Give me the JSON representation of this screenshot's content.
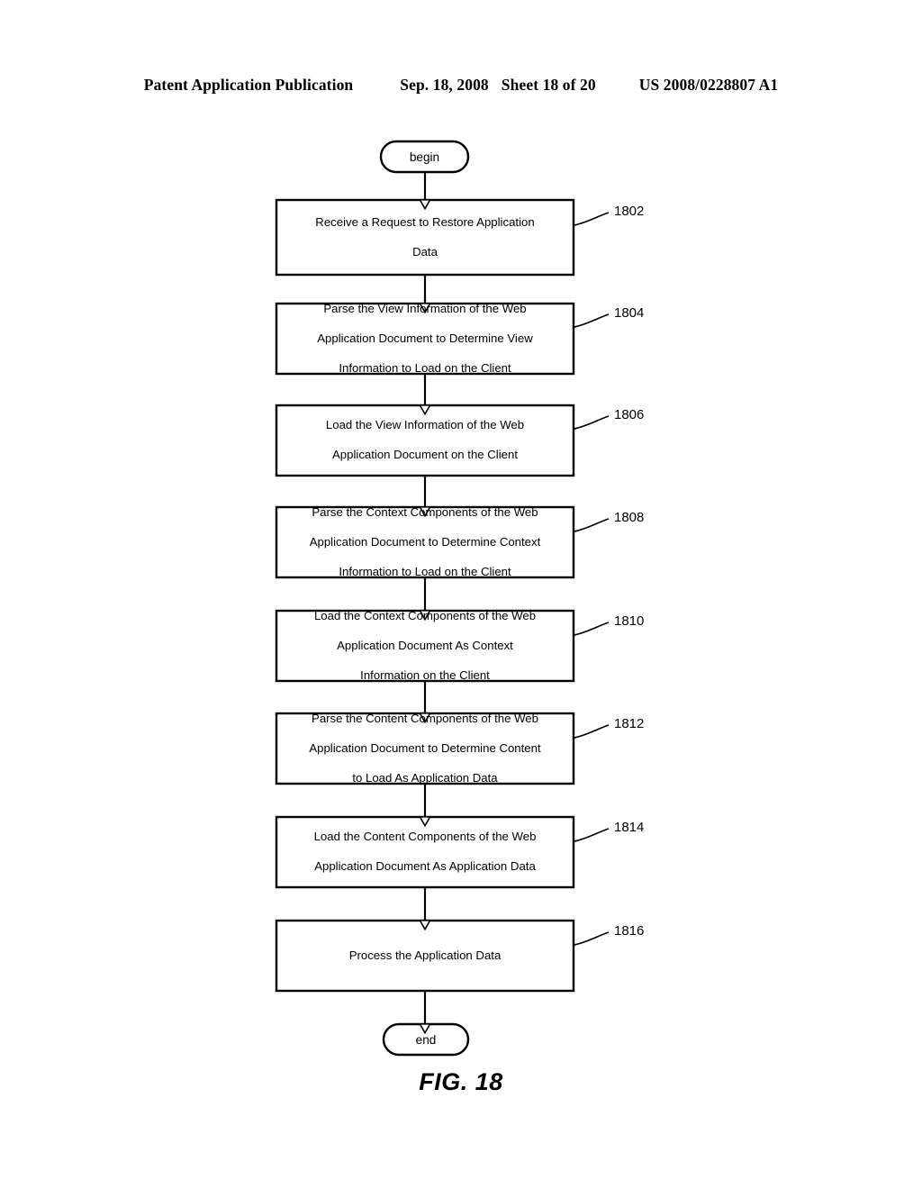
{
  "header": {
    "publication": "Patent Application Publication",
    "date": "Sep. 18, 2008",
    "sheet": "Sheet 18 of 20",
    "patent_number": "US 2008/0228807 A1"
  },
  "figure": {
    "caption": "FIG. 18",
    "start_label": "begin",
    "end_label": "end"
  },
  "flow": {
    "steps": [
      {
        "ref": "1802",
        "lines": [
          "Receive a Request to Restore Application",
          "Data"
        ]
      },
      {
        "ref": "1804",
        "lines": [
          "Parse the View Information of the Web",
          "Application Document to Determine View",
          "Information to Load on the Client"
        ]
      },
      {
        "ref": "1806",
        "lines": [
          "Load the View Information of the Web",
          "Application Document on the Client"
        ]
      },
      {
        "ref": "1808",
        "lines": [
          "Parse the Context Components of the Web",
          "Application Document to Determine Context",
          "Information to Load on the Client"
        ]
      },
      {
        "ref": "1810",
        "lines": [
          "Load the Context Components of the Web",
          "Application Document As Context",
          "Information on the Client"
        ]
      },
      {
        "ref": "1812",
        "lines": [
          "Parse the Content Components of the Web",
          "Application Document to Determine Content",
          "to Load As Application Data"
        ]
      },
      {
        "ref": "1814",
        "lines": [
          "Load the Content Components of the Web",
          "Application Document As Application Data"
        ]
      },
      {
        "ref": "1816",
        "lines": [
          "Process the Application Data"
        ]
      }
    ]
  },
  "colors": {
    "ink": "#000000",
    "paper": "#ffffff"
  }
}
